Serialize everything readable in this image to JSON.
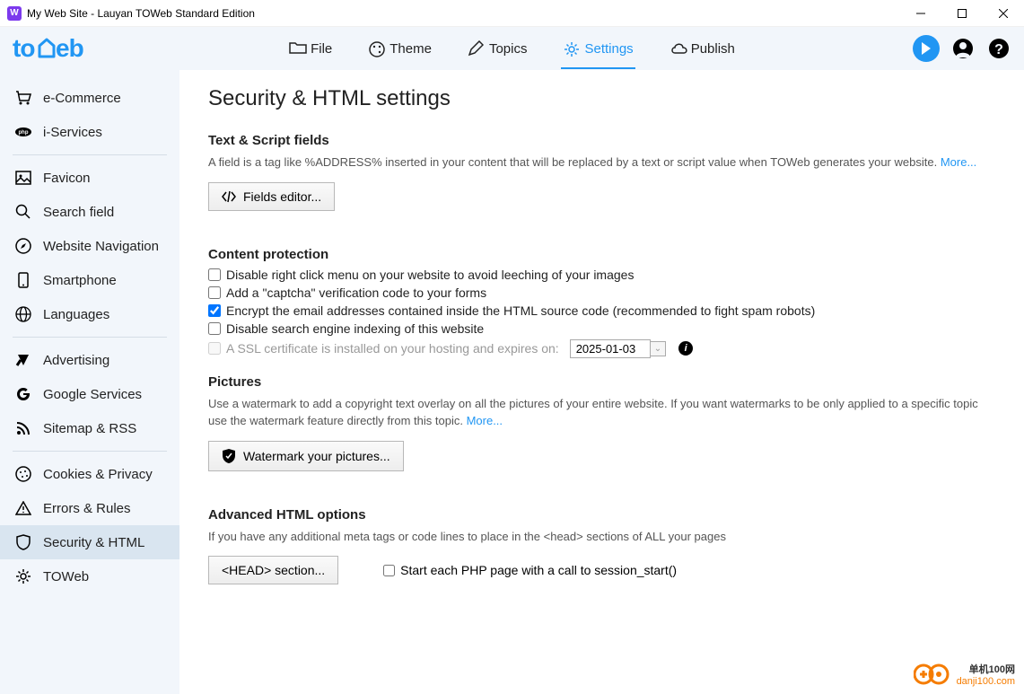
{
  "window": {
    "title": "My Web Site - Lauyan TOWeb Standard Edition"
  },
  "logo": {
    "text": "toweb"
  },
  "topnav": {
    "file": "File",
    "theme": "Theme",
    "topics": "Topics",
    "settings": "Settings",
    "publish": "Publish"
  },
  "sidebar": {
    "ecommerce": "e-Commerce",
    "iservices": "i-Services",
    "favicon": "Favicon",
    "search": "Search field",
    "navigation": "Website Navigation",
    "smartphone": "Smartphone",
    "languages": "Languages",
    "advertising": "Advertising",
    "google": "Google Services",
    "sitemap": "Sitemap & RSS",
    "cookies": "Cookies & Privacy",
    "errors": "Errors & Rules",
    "security": "Security & HTML",
    "toweb": "TOWeb"
  },
  "page": {
    "title": "Security & HTML settings",
    "section1": {
      "title": "Text & Script fields",
      "desc": "A field is a tag like %ADDRESS% inserted in your content that will be replaced by a text or script value when TOWeb generates your website.",
      "more": "More...",
      "btn": "Fields editor..."
    },
    "section2": {
      "title": "Content protection",
      "cb1": "Disable right click menu on your website to avoid leeching of your images",
      "cb2": "Add a \"captcha\" verification code to your forms",
      "cb3": "Encrypt the email addresses contained inside the HTML source code (recommended to fight spam robots)",
      "cb4": "Disable search engine indexing of this website",
      "cb5": "A SSL certificate is installed on your hosting and expires on:",
      "date": "2025-01-03"
    },
    "section3": {
      "title": "Pictures",
      "desc": "Use a watermark to add a copyright text overlay on all the pictures of your entire website. If you want watermarks to be only applied to a specific topic use the watermark feature directly from this topic.",
      "more": "More...",
      "btn": "Watermark your pictures..."
    },
    "section4": {
      "title": "Advanced HTML options",
      "desc": "If you have any additional meta tags or code lines to place in the <head> sections of ALL your pages",
      "btn": "<HEAD> section...",
      "cb": "Start each PHP page with a call to session_start()"
    }
  },
  "watermark": {
    "line1": "单机100网",
    "line2": "danji100.com"
  }
}
